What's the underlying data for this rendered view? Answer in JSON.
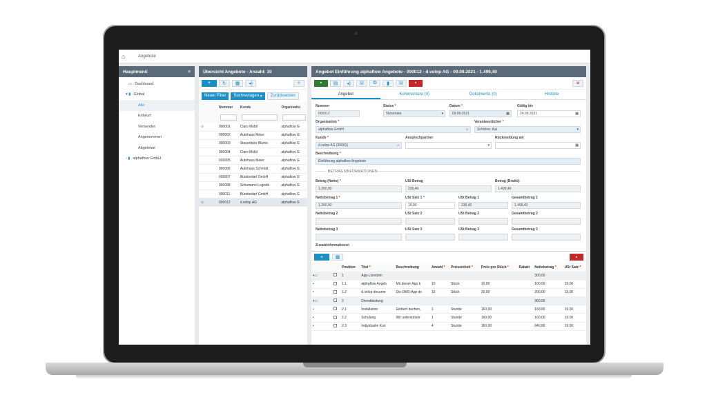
{
  "topbar": {
    "breadcrumb": "Angebote"
  },
  "left": {
    "title": "Hauptmenü",
    "items": [
      {
        "label": "Dashboard",
        "indent": 14
      },
      {
        "label": "Global",
        "indent": 10
      },
      {
        "label": "Alle",
        "indent": 28
      },
      {
        "label": "Entwurf",
        "indent": 28
      },
      {
        "label": "Versendet",
        "indent": 28
      },
      {
        "label": "Angenommen",
        "indent": 28
      },
      {
        "label": "Abgelehnt",
        "indent": 28
      },
      {
        "label": "alphaflow GmbH",
        "indent": 10
      }
    ]
  },
  "mid": {
    "title": "Übersicht Angebote - Anzahl: 10",
    "filter_new": "Neuer Filter",
    "filter_templates": "Suchvorlagen",
    "filter_reset": "Zurücksetzen",
    "columns": [
      "Nummer",
      "Kunde",
      "Organisatio"
    ],
    "rows": [
      [
        "000001",
        "Claro Mobil",
        "alphaflow G"
      ],
      [
        "000002",
        "Autohaus Meier",
        "alphaflow G"
      ],
      [
        "000003",
        "Steuerbüro Blume",
        "alphaflow G"
      ],
      [
        "000004",
        "Claro Mobil",
        "alphaflow G"
      ],
      [
        "000005",
        "Autohaus Meier",
        "alphaflow G"
      ],
      [
        "000006",
        "Autohaus Schmidt",
        "alphaflow G"
      ],
      [
        "000007",
        "Bürobedarf GmbH",
        "alphaflow G"
      ],
      [
        "000008",
        "Schumann Logistik",
        "alphaflow G"
      ],
      [
        "000011",
        "Bürobedarf GmbH",
        "alphaflow G"
      ],
      [
        "000012",
        "d.velop AG",
        "alphaflow G"
      ]
    ]
  },
  "detail": {
    "title": "Angebot Einführung alphaflow Angebote - 000012 - d.velop AG - 09.09.2021 - 1.499,40",
    "tabs": [
      "Angebot",
      "Kommentare (0)",
      "Dokumente (0)",
      "Historie"
    ],
    "labels": {
      "nummer": "Nummer",
      "status": "Status",
      "datum": "Datum",
      "gueltig": "Gültig bis",
      "organisation": "Organisation",
      "verantwortlicher": "Verantwortlicher",
      "kunde": "Kunde",
      "ansprechpartner": "Ansprechpartner",
      "rueckmeldung": "Rückmeldung am",
      "beschreibung": "Beschreibung",
      "section": "BETRAGSINFORMATIONEN",
      "betrag_netto": "Betrag (Netto)",
      "ust_betrag": "USt Betrag",
      "betrag_brutto": "Betrag (Brutto)",
      "nb1": "Nettobetrag 1",
      "us1": "USt Satz 1",
      "ub1": "USt Betrag 1",
      "gb1": "Gesamtbetrag 1",
      "nb2": "Nettobetrag 2",
      "us2": "USt Satz 2",
      "ub2": "USt Betrag 2",
      "gb2": "Gesamtbetrag 2",
      "nb3": "Nettobetrag 3",
      "us3": "USt Satz 3",
      "ub3": "USt Betrag 3",
      "gb3": "Gesamtbetrag 3",
      "zusatz": "Zusatzinformationen"
    },
    "values": {
      "nummer": "000012",
      "status": "Versendet",
      "datum": "09.09.2021",
      "gueltig": "24.09.2021",
      "organisation": "alphaflow GmbH",
      "verantwortlicher": "Schickor, Kai",
      "kunde": "d.velop AG (20001)",
      "beschreibung": "Einführung alphaflow Angebote",
      "betrag_netto": "1.260,00",
      "ust_betrag": "239,40",
      "betrag_brutto": "1.499,40",
      "nb1": "1.260,00",
      "us1": "19,00",
      "ub1": "239,40",
      "gb1": "1.499,40"
    }
  },
  "positions": {
    "columns": [
      "Position",
      "Titel",
      "Beschreibung",
      "Anzahl",
      "Preiseinheit",
      "Preis pro Stück",
      "Rabatt",
      "Nettobetrag",
      "USt Satz"
    ],
    "required": [
      false,
      true,
      false,
      true,
      true,
      true,
      false,
      true,
      true
    ],
    "rows": [
      {
        "group": true,
        "pos": "1",
        "titel": "App-Lizenzen",
        "beschr": "",
        "anzahl": "",
        "einheit": "",
        "preis": "",
        "rabatt": "",
        "netto": "300,00",
        "ust": ""
      },
      {
        "group": false,
        "pos": "1.1",
        "titel": "alphaflow Angeb",
        "beschr": "Mit dieser App k",
        "anzahl": "10",
        "einheit": "Stück",
        "preis": "10,00",
        "rabatt": "",
        "netto": "100,00",
        "ust": "19,00"
      },
      {
        "group": false,
        "pos": "1.2",
        "titel": "d.velop docume",
        "beschr": "Die DMS-App de",
        "anzahl": "10",
        "einheit": "Stück",
        "preis": "20,00",
        "rabatt": "",
        "netto": "200,00",
        "ust": "19,00"
      },
      {
        "group": true,
        "pos": "2",
        "titel": "Dienstleistung",
        "beschr": "",
        "anzahl": "",
        "einheit": "",
        "preis": "",
        "rabatt": "",
        "netto": "960,00",
        "ust": ""
      },
      {
        "group": false,
        "pos": "2.1",
        "titel": "Installation",
        "beschr": "Einfach buchen,",
        "anzahl": "1",
        "einheit": "Stunde",
        "preis": "160,00",
        "rabatt": "",
        "netto": "160,00",
        "ust": "19,00"
      },
      {
        "group": false,
        "pos": "2.2",
        "titel": "Schulung",
        "beschr": "Wir unterstützer",
        "anzahl": "1",
        "einheit": "Stunde",
        "preis": "160,00",
        "rabatt": "",
        "netto": "160,00",
        "ust": "19,00"
      },
      {
        "group": false,
        "pos": "2.3",
        "titel": "Individuelle Kun",
        "beschr": "",
        "anzahl": "4",
        "einheit": "Stunde",
        "preis": "160,00",
        "rabatt": "",
        "netto": "640,00",
        "ust": "19,00"
      }
    ]
  },
  "colors": {
    "accent": "#1d8fc7",
    "header": "#5a6a78",
    "save": "#2e7d32",
    "delete": "#c62828"
  }
}
